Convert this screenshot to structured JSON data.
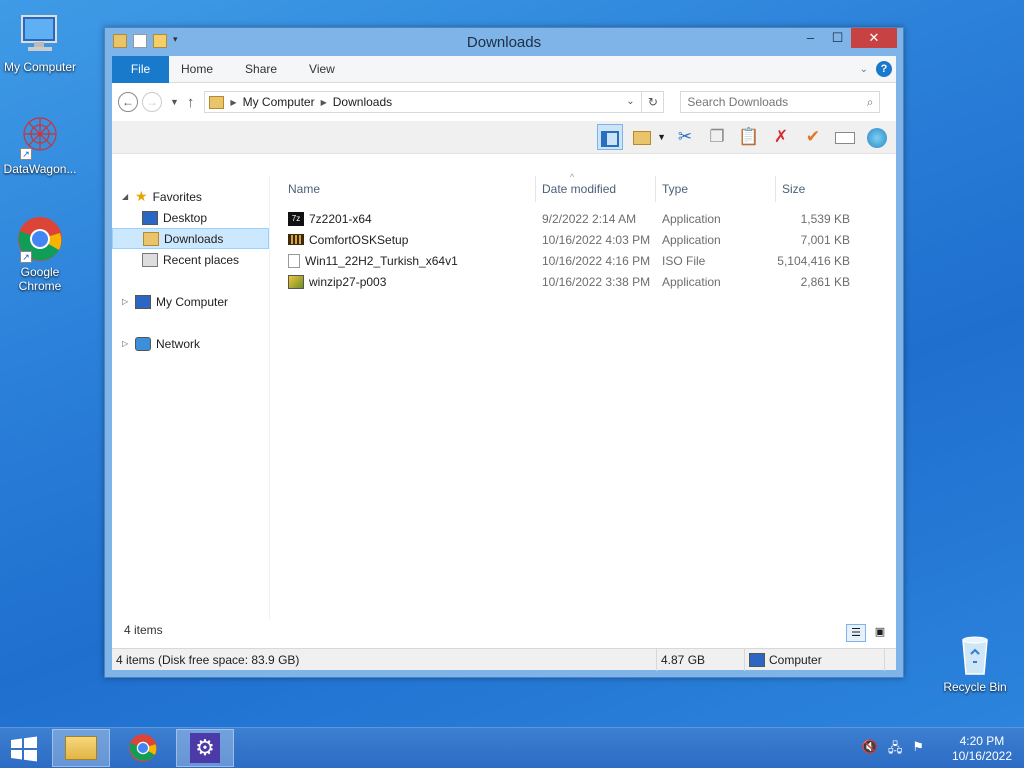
{
  "desktop": {
    "icons": [
      {
        "label": "My Computer"
      },
      {
        "label": "DataWagon..."
      },
      {
        "label": "Google Chrome"
      },
      {
        "label": "Recycle Bin"
      }
    ]
  },
  "window": {
    "title": "Downloads",
    "controls": {
      "minimize": "–",
      "maximize": "☐",
      "close": "✕"
    }
  },
  "ribbon": {
    "file": "File",
    "tabs": [
      "Home",
      "Share",
      "View"
    ],
    "help": "?"
  },
  "address": {
    "crumbs": [
      "My Computer",
      "Downloads"
    ],
    "search_placeholder": "Search Downloads"
  },
  "nav": {
    "favorites": "Favorites",
    "desktop": "Desktop",
    "downloads": "Downloads",
    "recent": "Recent places",
    "computer": "My Computer",
    "network": "Network"
  },
  "columns": {
    "name": "Name",
    "date": "Date modified",
    "type": "Type",
    "size": "Size"
  },
  "files": [
    {
      "name": "7z2201-x64",
      "date": "9/2/2022 2:14 AM",
      "type": "Application",
      "size": "1,539 KB"
    },
    {
      "name": "ComfortOSKSetup",
      "date": "10/16/2022 4:03 PM",
      "type": "Application",
      "size": "7,001 KB"
    },
    {
      "name": "Win11_22H2_Turkish_x64v1",
      "date": "10/16/2022 4:16 PM",
      "type": "ISO File",
      "size": "5,104,416 KB"
    },
    {
      "name": "winzip27-p003",
      "date": "10/16/2022 3:38 PM",
      "type": "Application",
      "size": "2,861 KB"
    }
  ],
  "status": {
    "item_count": "4 items",
    "disk": "4 items (Disk free space: 83.9 GB)",
    "size": "4.87 GB",
    "location": "Computer"
  },
  "taskbar": {
    "time": "4:20 PM",
    "date": "10/16/2022"
  },
  "colors": {
    "accent": "#1979ca",
    "close": "#c74343",
    "selection": "#cce8ff"
  }
}
